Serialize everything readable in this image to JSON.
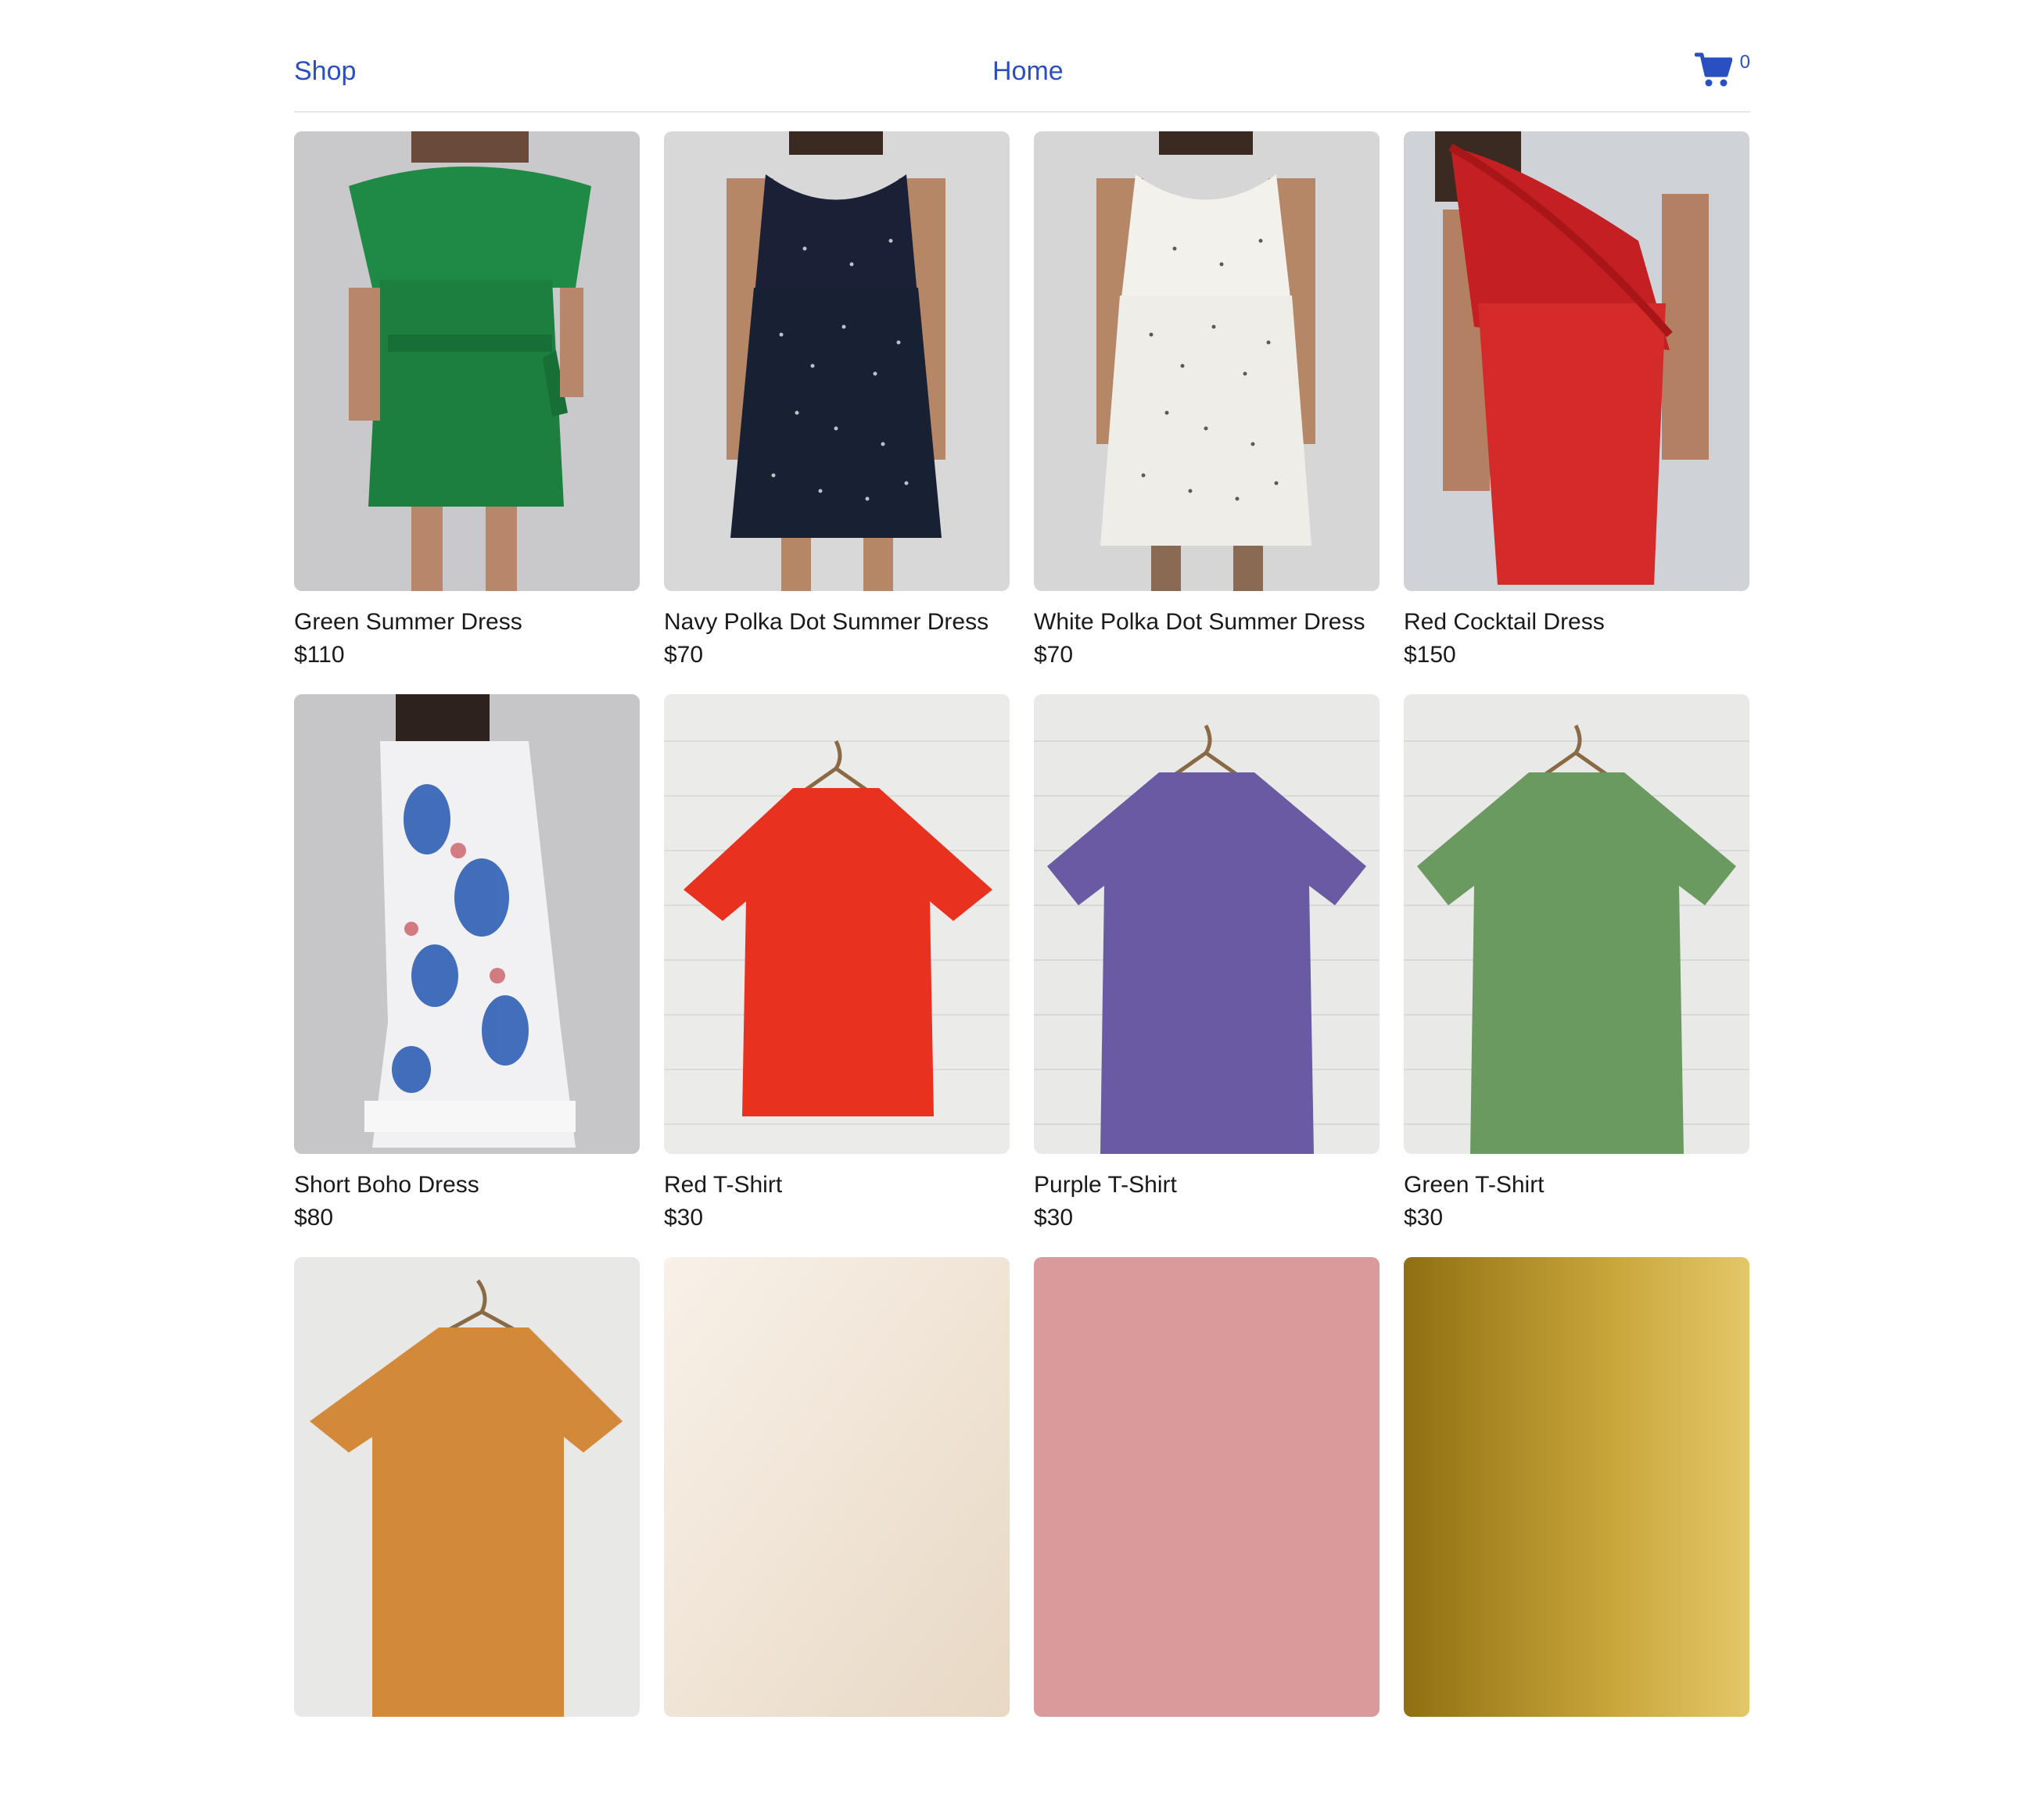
{
  "nav": {
    "shop_label": "Shop",
    "home_label": "Home",
    "cart_count": "0",
    "link_color": "#2a4fc0"
  },
  "products": [
    {
      "name": "Green Summer Dress",
      "price": "$110",
      "image": "green-off-shoulder-dress-photo",
      "color": "#1f8a45"
    },
    {
      "name": "Navy Polka Dot Summer Dress",
      "price": "$70",
      "image": "navy-polka-dot-dress-photo",
      "color": "#1a2136"
    },
    {
      "name": "White Polka Dot Summer Dress",
      "price": "$70",
      "image": "white-polka-dot-dress-photo",
      "color": "#f3f1ec"
    },
    {
      "name": "Red Cocktail Dress",
      "price": "$150",
      "image": "red-ruffle-dress-photo",
      "color": "#d42a2a"
    },
    {
      "name": "Short Boho Dress",
      "price": "$80",
      "image": "blue-paisley-boho-dress-photo",
      "color": "#2f5fb5"
    },
    {
      "name": "Red T-Shirt",
      "price": "$30",
      "image": "red-tshirt-on-hanger-photo",
      "color": "#e8321f"
    },
    {
      "name": "Purple T-Shirt",
      "price": "$30",
      "image": "purple-tshirt-on-hanger-photo",
      "color": "#6a5aa3"
    },
    {
      "name": "Green T-Shirt",
      "price": "$30",
      "image": "green-tshirt-on-hanger-photo",
      "color": "#6b9a60"
    },
    {
      "name": "",
      "price": "",
      "image": "tshirt-on-hanger-photo-partial",
      "color": "#e8e8e6"
    },
    {
      "name": "",
      "price": "",
      "image": "cream-product-photo-partial",
      "color": "#f4ece2"
    },
    {
      "name": "",
      "price": "",
      "image": "pink-product-photo-partial",
      "color": "#d99a9c"
    },
    {
      "name": "",
      "price": "",
      "image": "gold-product-photo-partial",
      "color": "#b9962a"
    }
  ]
}
